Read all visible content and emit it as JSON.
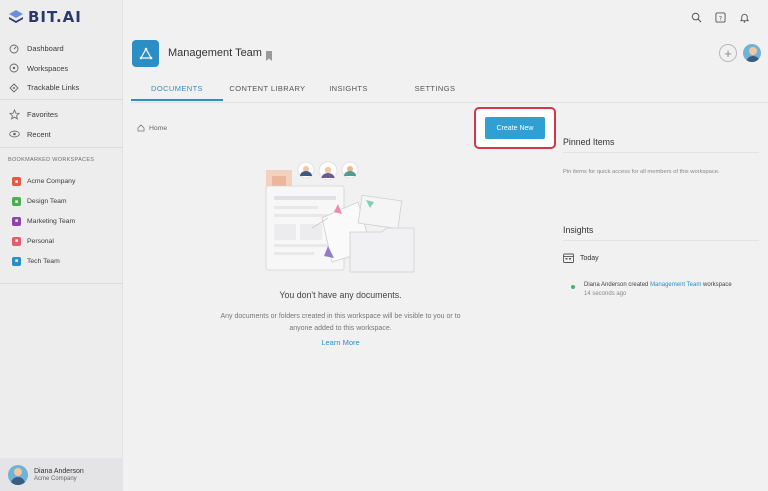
{
  "app": {
    "logo_text": "BIT.AI"
  },
  "sidebar": {
    "nav": [
      {
        "label": "Dashboard",
        "icon": "dashboard-icon"
      },
      {
        "label": "Workspaces",
        "icon": "workspaces-icon"
      },
      {
        "label": "Trackable Links",
        "icon": "link-icon"
      }
    ],
    "secondary": [
      {
        "label": "Favorites",
        "icon": "star-icon"
      },
      {
        "label": "Recent",
        "icon": "eye-icon"
      }
    ],
    "section_title": "BOOKMARKED WORKSPACES",
    "workspaces": [
      {
        "label": "Acme Company",
        "color": "#e05a47"
      },
      {
        "label": "Design Team",
        "color": "#4caf50"
      },
      {
        "label": "Marketing Team",
        "color": "#8e44ad"
      },
      {
        "label": "Personal",
        "color": "#e35d6a"
      },
      {
        "label": "Tech Team",
        "color": "#2b8fc6"
      }
    ],
    "user": {
      "name": "Diana Anderson",
      "org": "Acme Company"
    }
  },
  "header": {
    "title": "Management Team",
    "tabs": [
      {
        "label": "DOCUMENTS",
        "active": true
      },
      {
        "label": "CONTENT LIBRARY",
        "active": false
      },
      {
        "label": "INSIGHTS",
        "active": false
      },
      {
        "label": "SETTINGS",
        "active": false
      }
    ]
  },
  "main": {
    "breadcrumb": "Home",
    "create_button": "Create New",
    "empty_title": "You don't have any documents.",
    "empty_desc_line1": "Any documents or folders created in this workspace will be visible to you or to",
    "empty_desc_line2": "anyone added to this workspace.",
    "learn_more": "Learn More"
  },
  "right_panel": {
    "pinned_title": "Pinned Items",
    "pinned_desc": "Pin items for quick access for all members of this workspace.",
    "insights_title": "Insights",
    "today_label": "Today",
    "activity": {
      "user": "Diana Anderson",
      "action": "created",
      "target": "Management Team",
      "suffix": "workspace",
      "time": "14 seconds ago"
    }
  },
  "colors": {
    "accent": "#2b8fc6",
    "highlight": "#d4354b",
    "button": "#2f9fd4"
  }
}
